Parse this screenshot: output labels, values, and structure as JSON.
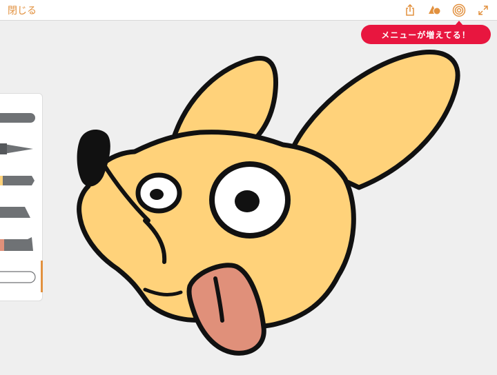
{
  "toolbar": {
    "close_label": "閉じる",
    "accent_color": "#e2913f",
    "icons": [
      "share-icon",
      "shapes-icon",
      "target-icon",
      "expand-icon"
    ]
  },
  "tooltip": {
    "text": "メニューが増えてる！",
    "color": "#e8163f"
  },
  "palette": {
    "tools": [
      "marker",
      "pen",
      "highlighter",
      "pencil",
      "crayon",
      "eraser"
    ]
  },
  "drawing": {
    "subject": "dog-face",
    "fill_color": "#ffd27a",
    "tongue_color": "#e0907a"
  }
}
